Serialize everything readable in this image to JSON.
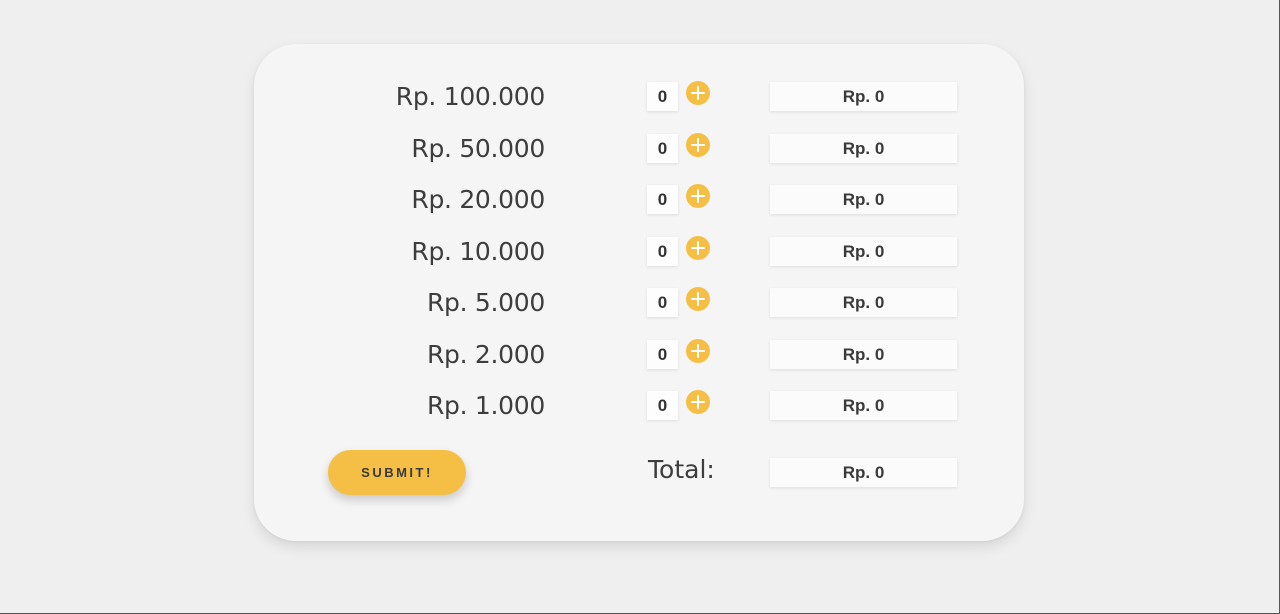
{
  "colors": {
    "accent": "#f5bf45",
    "background": "#efefef",
    "card": "#f5f5f5",
    "text": "#3d3d3d"
  },
  "denominations": [
    {
      "label": "Rp. 100.000",
      "quantity": "0",
      "amount": "Rp. 0"
    },
    {
      "label": "Rp. 50.000",
      "quantity": "0",
      "amount": "Rp. 0"
    },
    {
      "label": "Rp. 20.000",
      "quantity": "0",
      "amount": "Rp. 0"
    },
    {
      "label": "Rp. 10.000",
      "quantity": "0",
      "amount": "Rp. 0"
    },
    {
      "label": "Rp. 5.000",
      "quantity": "0",
      "amount": "Rp. 0"
    },
    {
      "label": "Rp. 2.000",
      "quantity": "0",
      "amount": "Rp. 0"
    },
    {
      "label": "Rp. 1.000",
      "quantity": "0",
      "amount": "Rp. 0"
    }
  ],
  "icons": {
    "increment": "plus-circle-icon"
  },
  "submit_label": "SUBMIT!",
  "total": {
    "label": "Total:",
    "amount": "Rp. 0"
  }
}
